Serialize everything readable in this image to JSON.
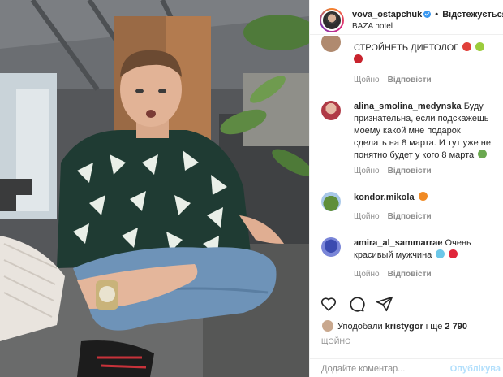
{
  "post": {
    "image_alt": "Man in a black-and-white geometric sweater sitting cross-legged with a surprised expression",
    "username": "vova_ostapchuk",
    "follow_label": "Відстежується",
    "location": "BAZA hotel"
  },
  "comments": [
    {
      "user": "",
      "text": "СТРОЙНЕТЬ ДИЕТОЛОГ",
      "like_label": "Щойно",
      "reply_label": "Відповісти",
      "emoji": [
        "strawberry",
        "apple",
        "cherry"
      ]
    },
    {
      "user": "alina_smolina_medynska",
      "text": "Буду признательна, если подскажешь моему какой мне подарок сделать на 8 марта. И тут уже не понятно будет у кого 8 марта",
      "like_label": "Щойно",
      "reply_label": "Відповісти",
      "emoji": [
        "alien"
      ]
    },
    {
      "user": "kondor.mikola",
      "text": "",
      "like_label": "Щойно",
      "reply_label": "Відповісти",
      "emoji": [
        "fire"
      ]
    },
    {
      "user": "amira_al_sammarrae",
      "text": "Очень красивый мужчина",
      "like_label": "Щойно",
      "reply_label": "Відповісти",
      "emoji": [
        "gem",
        "heart"
      ]
    }
  ],
  "likes": {
    "prefix": "Уподобали",
    "user": "kristygor",
    "connector": "і ще",
    "count": "2 790"
  },
  "date": "ЩОЙНО",
  "add_comment": {
    "placeholder": "Додайте коментар...",
    "publish_label": "Опублікува"
  },
  "colors": {
    "link_blue": "#0095f6",
    "publish_disabled": "#b2dffc",
    "meta_gray": "#8e8e8e"
  }
}
